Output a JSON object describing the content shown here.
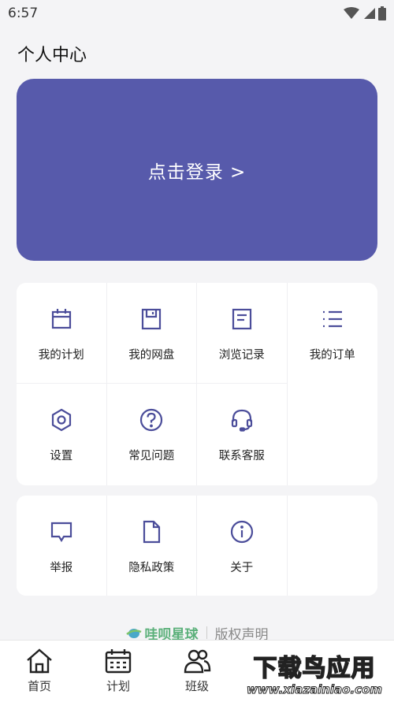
{
  "status_bar": {
    "time": "6:57"
  },
  "header": {
    "title": "个人中心"
  },
  "login": {
    "label": "点击登录 >"
  },
  "menu_primary": [
    {
      "label": "我的计划",
      "icon": "calendar-icon"
    },
    {
      "label": "我的网盘",
      "icon": "floppy-disk-icon"
    },
    {
      "label": "浏览记录",
      "icon": "document-icon"
    },
    {
      "label": "我的订单",
      "icon": "list-icon"
    },
    {
      "label": "设置",
      "icon": "hexagon-settings-icon"
    },
    {
      "label": "常见问题",
      "icon": "question-circle-icon"
    },
    {
      "label": "联系客服",
      "icon": "headset-icon"
    }
  ],
  "menu_secondary": [
    {
      "label": "举报",
      "icon": "speech-bubble-icon"
    },
    {
      "label": "隐私政策",
      "icon": "file-icon"
    },
    {
      "label": "关于",
      "icon": "info-circle-icon"
    }
  ],
  "footer": {
    "brand": "哇呗星球",
    "copyright": "版权声明"
  },
  "tabs": [
    {
      "label": "首页",
      "icon": "home-icon"
    },
    {
      "label": "计划",
      "icon": "calendar-tab-icon"
    },
    {
      "label": "班级",
      "icon": "group-icon"
    }
  ],
  "watermark": {
    "title": "下载鸟应用",
    "url": "www.xiazainiao.com"
  },
  "colors": {
    "accent": "#575aab",
    "icon": "#4b4d9a",
    "background": "#f4f4f6"
  }
}
